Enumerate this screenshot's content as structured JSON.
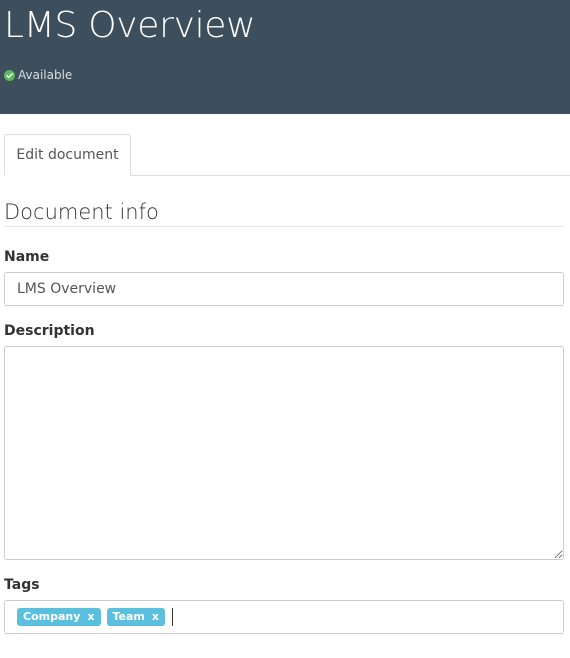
{
  "header": {
    "title": "LMS Overview",
    "status": {
      "label": "Available",
      "icon": "check-circle-icon",
      "color": "#5cb85c"
    },
    "background": "#3d4f5c"
  },
  "tabs": [
    {
      "label": "Edit document",
      "active": true
    }
  ],
  "section": {
    "title": "Document info"
  },
  "form": {
    "name": {
      "label": "Name",
      "value": "LMS Overview"
    },
    "description": {
      "label": "Description",
      "value": ""
    },
    "tags": {
      "label": "Tags",
      "items": [
        {
          "label": "Company",
          "remove": "x"
        },
        {
          "label": "Team",
          "remove": "x"
        }
      ],
      "tag_color": "#5bc0de"
    }
  }
}
